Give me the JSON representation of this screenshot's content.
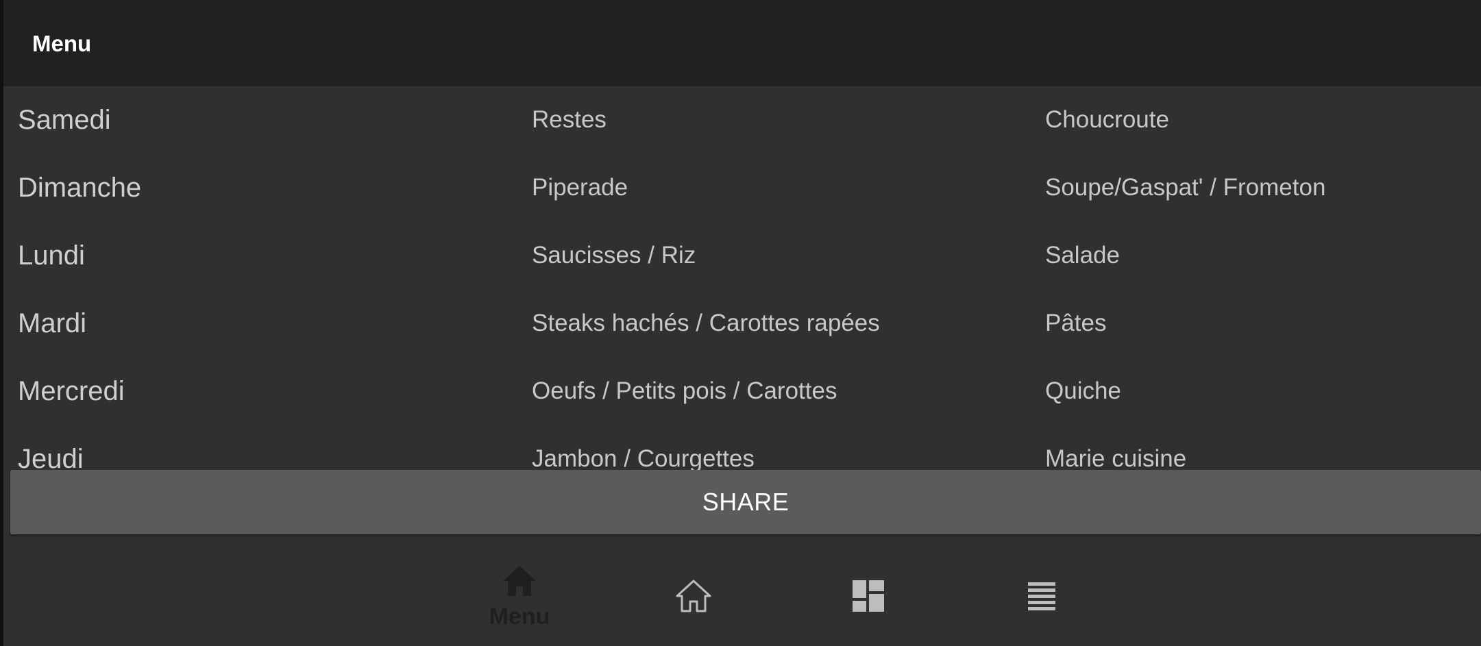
{
  "appbar": {
    "title": "Menu"
  },
  "menu": {
    "rows": [
      {
        "day": "Samedi",
        "lunch": "Restes",
        "dinner": "Choucroute"
      },
      {
        "day": "Dimanche",
        "lunch": "Piperade",
        "dinner": "Soupe/Gaspat' / Frometon"
      },
      {
        "day": "Lundi",
        "lunch": "Saucisses / Riz",
        "dinner": "Salade"
      },
      {
        "day": "Mardi",
        "lunch": "Steaks hachés / Carottes rapées",
        "dinner": "Pâtes"
      },
      {
        "day": "Mercredi",
        "lunch": "Oeufs / Petits pois / Carottes",
        "dinner": "Quiche"
      },
      {
        "day": "Jeudi",
        "lunch": "Jambon / Courgettes",
        "dinner": "Marie cuisine"
      }
    ]
  },
  "share_button": {
    "label": "SHARE"
  },
  "bottom_nav": {
    "items": [
      {
        "icon": "home-filled-icon",
        "label": "Menu",
        "selected": true
      },
      {
        "icon": "home-outline-icon",
        "label": ""
      },
      {
        "icon": "dashboard-icon",
        "label": ""
      },
      {
        "icon": "list-icon",
        "label": ""
      }
    ]
  },
  "colors": {
    "appbar_bg": "#212121",
    "content_bg": "#303030",
    "button_bg": "#5b5b5c",
    "text_primary": "#ffffff",
    "text_secondary": "#c8c8c8"
  }
}
